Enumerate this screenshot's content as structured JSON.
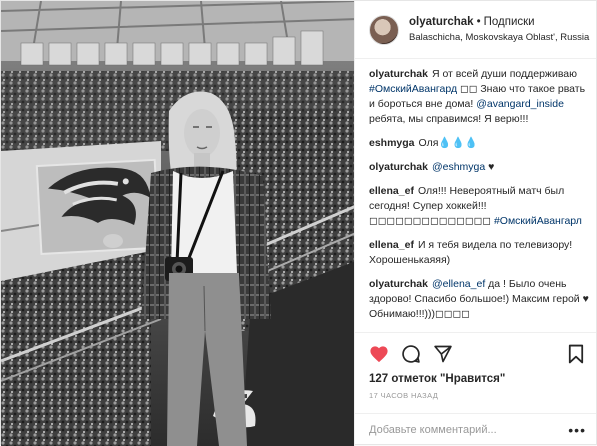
{
  "header": {
    "username": "olyaturchak",
    "separator": "•",
    "follow_label": "Подписки",
    "location": "Balaschicha, Moskovskaya Oblast', Russia"
  },
  "comments": [
    {
      "user": "olyaturchak",
      "parts": [
        {
          "t": "Я от всей души поддерживаю ",
          "link": false
        },
        {
          "t": "#ОмскийАвангард",
          "link": true
        },
        {
          "t": " ◻◻ Знаю что такое рвать и бороться вне дома! ",
          "link": false
        },
        {
          "t": "@avangard_inside",
          "link": true
        },
        {
          "t": " ребята, мы справимся! Я верю!!!",
          "link": false
        }
      ]
    },
    {
      "user": "eshmyga",
      "parts": [
        {
          "t": "Оля💧💧💧",
          "link": false
        }
      ]
    },
    {
      "user": "olyaturchak",
      "parts": [
        {
          "t": "@eshmyga",
          "link": true
        },
        {
          "t": " ♥",
          "link": false
        }
      ]
    },
    {
      "user": "ellena_ef",
      "parts": [
        {
          "t": "Оля!!! Невероятный матч был сегодня! Супер хоккей!!! ◻◻◻◻◻◻◻◻◻◻◻◻◻◻ ",
          "link": false
        },
        {
          "t": "#ОмскийАвангарл",
          "link": true
        }
      ]
    },
    {
      "user": "ellena_ef",
      "parts": [
        {
          "t": "И я тебя видела по телевизору! Хорошенькаяяя)",
          "link": false
        }
      ]
    },
    {
      "user": "olyaturchak",
      "parts": [
        {
          "t": "@ellena_ef",
          "link": true
        },
        {
          "t": " да ! Было очень здорово! Спасибо большое!) Максим герой ♥ Обнимаю!!!)))◻◻◻◻",
          "link": false
        }
      ]
    }
  ],
  "actions": {
    "like_icon": "heart-icon",
    "comment_icon": "comment-icon",
    "share_icon": "share-icon",
    "save_icon": "bookmark-icon",
    "liked_color": "#ed4956"
  },
  "likes_text": "127 отметок \"Нравится\"",
  "time_text": "17 часов назад",
  "add_comment": {
    "placeholder": "Добавьте комментарий...",
    "more_label": "•••"
  },
  "colors": {
    "link": "#003569",
    "text": "#262626",
    "muted": "#999999"
  }
}
